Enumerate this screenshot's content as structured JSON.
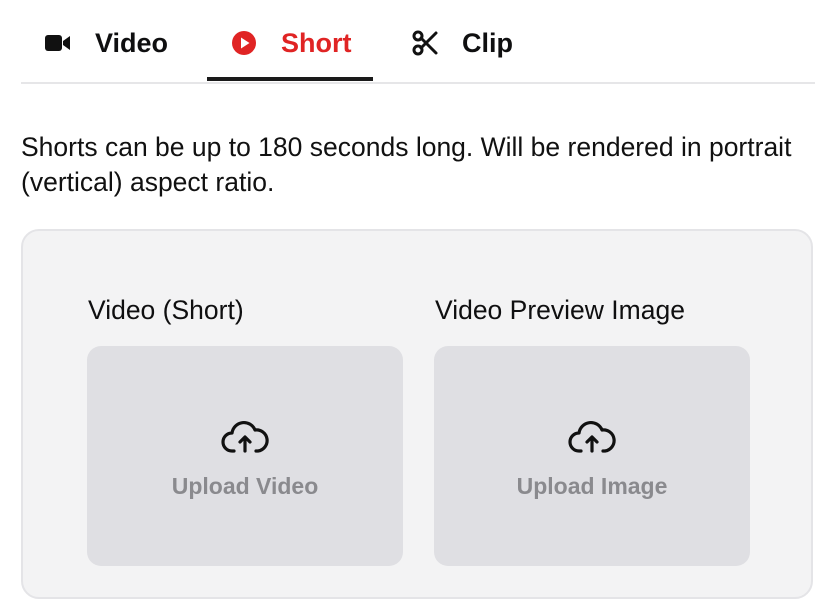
{
  "tabs": [
    {
      "label": "Video",
      "icon": "video-camera-icon",
      "active": false
    },
    {
      "label": "Short",
      "icon": "play-circle-icon",
      "active": true
    },
    {
      "label": "Clip",
      "icon": "scissors-icon",
      "active": false
    }
  ],
  "colors": {
    "active_tab": "#e02424",
    "panel_bg": "#f3f3f4",
    "dropzone_bg": "#dfdfe3",
    "muted_text": "#8a8a8e"
  },
  "description": "Shorts can be up to 180 seconds long. Will be rendered in portrait (vertical) aspect ratio.",
  "upload_panel": {
    "video_field": {
      "label": "Video (Short)",
      "button_text": "Upload Video",
      "icon": "cloud-upload-icon"
    },
    "preview_field": {
      "label": "Video Preview Image",
      "button_text": "Upload Image",
      "icon": "cloud-upload-icon"
    }
  }
}
